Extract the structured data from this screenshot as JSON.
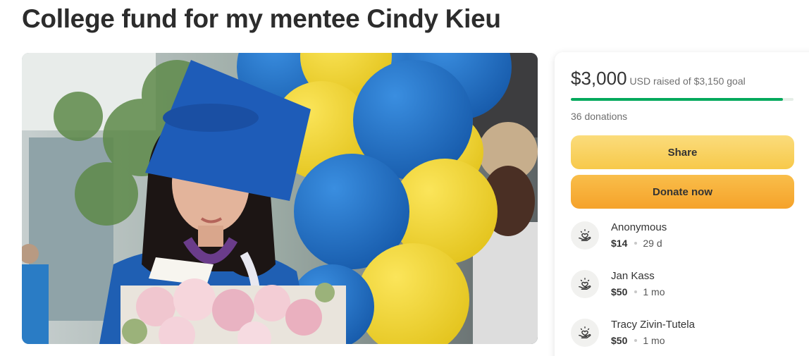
{
  "page": {
    "title": "College fund for my mentee Cindy Kieu"
  },
  "hero": {
    "image_alt": "Graduate in blue cap and gown with yellow and blue balloons"
  },
  "card": {
    "raised_amount": "$3,000",
    "raised_rest": "USD raised of $3,150 goal",
    "progress_fraction": 0.952,
    "donations_count": "36 donations",
    "share_label": "Share",
    "donate_label": "Donate now",
    "donors": [
      {
        "name": "Anonymous",
        "amount": "$14",
        "time": "29 d"
      },
      {
        "name": "Jan Kass",
        "amount": "$50",
        "time": "1 mo"
      },
      {
        "name": "Tracy Zivin-Tutela",
        "amount": "$50",
        "time": "1 mo"
      }
    ]
  },
  "colors": {
    "progress": "#02a95c",
    "share_button": "#f8cf5c",
    "donate_button": "#f6ad36",
    "balloon_blue": "#1f6fc4",
    "balloon_yellow": "#f3d62a"
  },
  "icons": {
    "donor": "heart-hand-icon"
  }
}
